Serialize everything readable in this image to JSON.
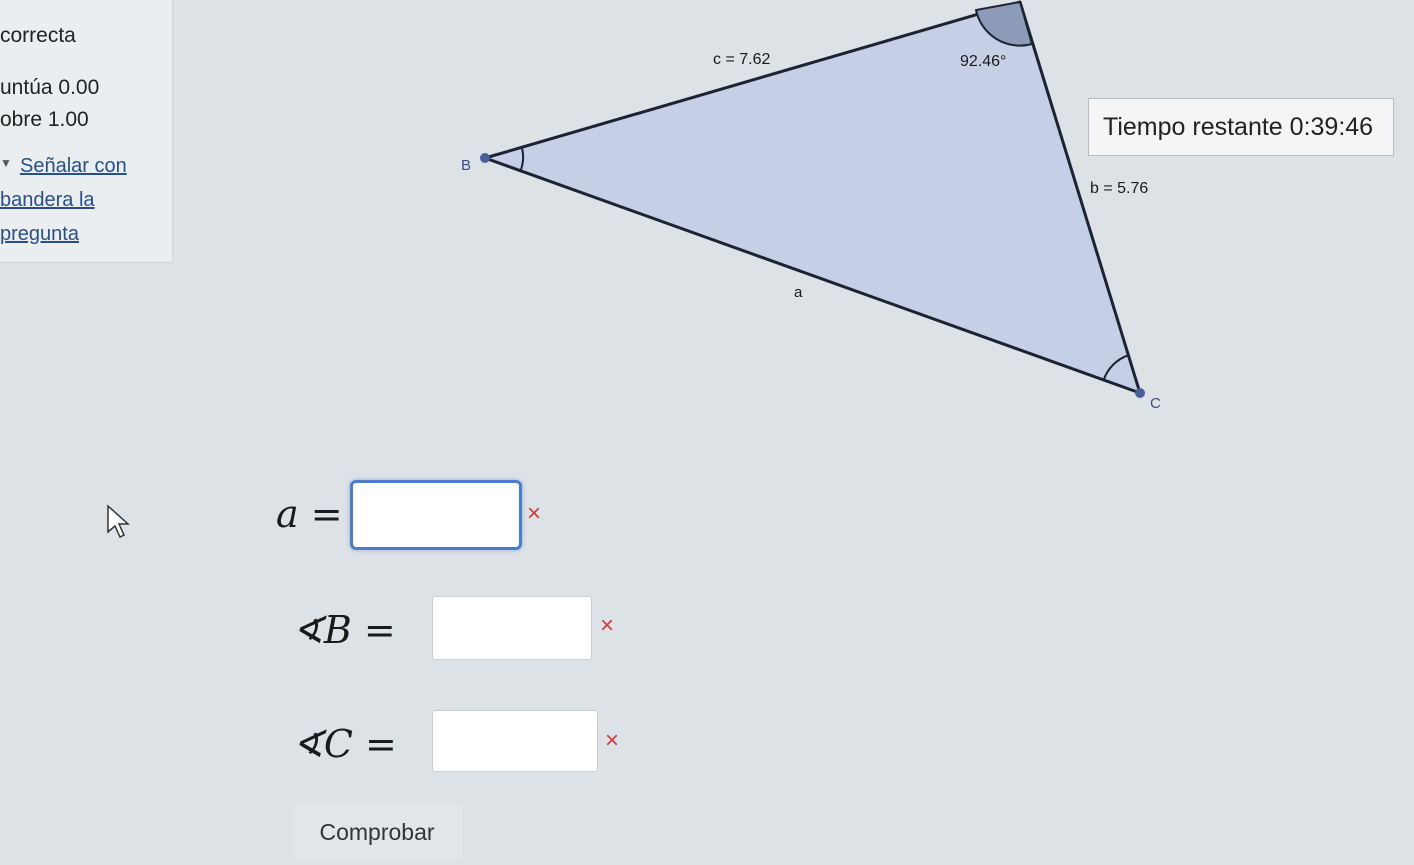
{
  "info": {
    "status": "correcta",
    "score": "untúa 0.00",
    "max": "obre 1.00",
    "flag_line1": "Señalar con",
    "flag_line2": "bandera la",
    "flag_line3": "pregunta"
  },
  "timer": {
    "label": "Tiempo restante",
    "value": "0:39:46"
  },
  "triangle": {
    "side_c": "c = 7.62",
    "angle_a": "92.46°",
    "side_b": "b = 5.76",
    "side_a": "a",
    "vertex_b": "B",
    "vertex_c": "C"
  },
  "answers": [
    {
      "label": "a =",
      "value": "",
      "mark": "×"
    },
    {
      "label": "∢B =",
      "value": "",
      "mark": "×"
    },
    {
      "label": "∢C =",
      "value": "",
      "mark": "×"
    }
  ],
  "button": {
    "label": "Comprobar"
  },
  "colors": {
    "triangle_fill": "#c5cfe6",
    "error": "#d13b3b",
    "focus": "#4a7ec9"
  }
}
